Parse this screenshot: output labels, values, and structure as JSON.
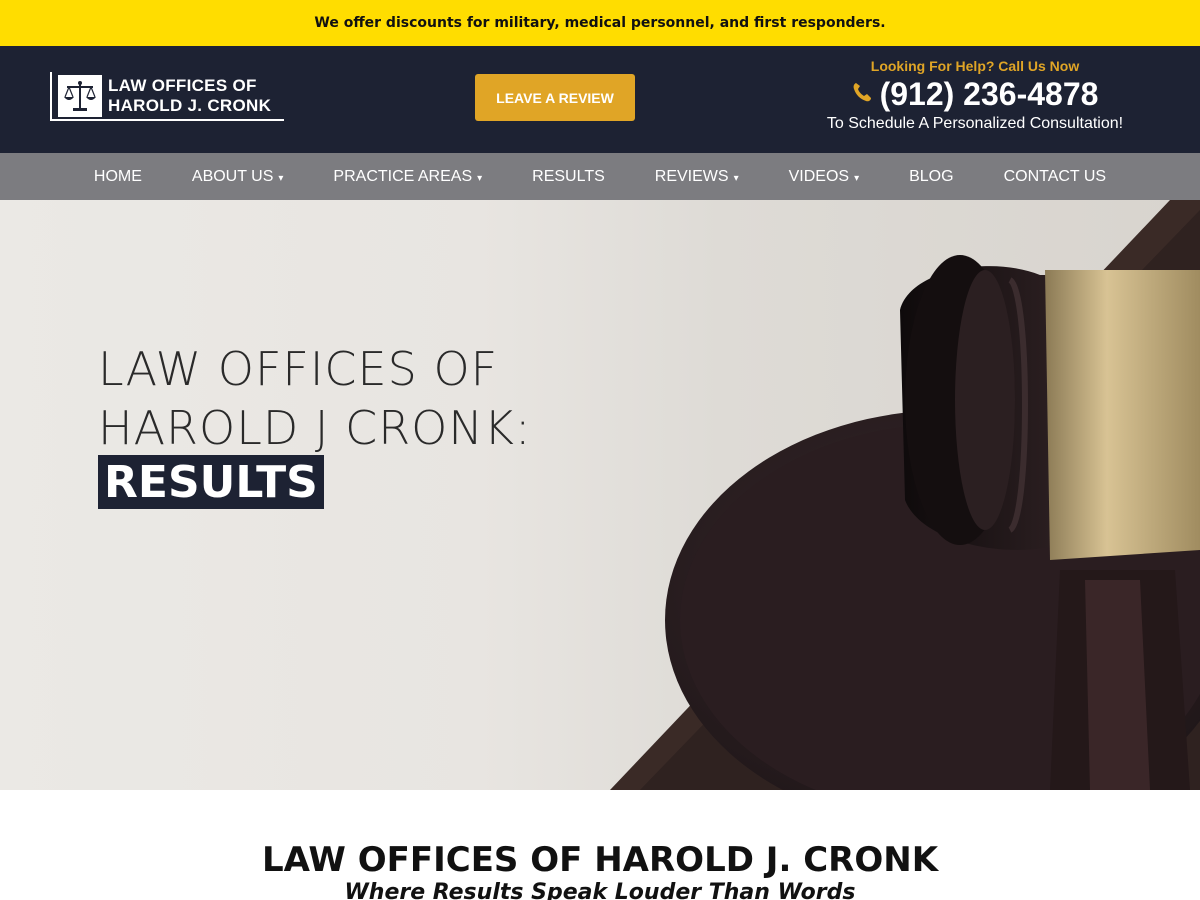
{
  "announcement": {
    "text": "We offer discounts for military, medical personnel, and first responders."
  },
  "header": {
    "logo": {
      "line1": "LAW OFFICES OF",
      "line2": "HAROLD J. CRONK",
      "icon": "scales-of-justice-icon"
    },
    "review_button": "LEAVE A REVIEW",
    "contact": {
      "help_text": "Looking For Help? Call Us Now",
      "phone": "(912) 236-4878",
      "phone_icon": "phone-icon",
      "schedule_text": "To Schedule A Personalized Consultation!"
    }
  },
  "nav": {
    "items": [
      {
        "label": "HOME",
        "has_dropdown": false
      },
      {
        "label": "ABOUT US",
        "has_dropdown": true
      },
      {
        "label": "PRACTICE AREAS",
        "has_dropdown": true
      },
      {
        "label": "RESULTS",
        "has_dropdown": false
      },
      {
        "label": "REVIEWS",
        "has_dropdown": true
      },
      {
        "label": "VIDEOS",
        "has_dropdown": true
      },
      {
        "label": "BLOG",
        "has_dropdown": false
      },
      {
        "label": "CONTACT US",
        "has_dropdown": false
      }
    ],
    "caret": "▾"
  },
  "hero": {
    "title_line1": "LAW OFFICES OF",
    "title_line2": "HAROLD J CRONK:",
    "badge": "RESULTS"
  },
  "content": {
    "heading": "LAW OFFICES OF HAROLD J. CRONK",
    "subheading": "Where Results Speak Louder Than Words"
  },
  "colors": {
    "announcement_bg": "#ffdd00",
    "header_bg": "#1d2233",
    "accent": "#e0a526",
    "nav_bg": "#7c7c80"
  }
}
